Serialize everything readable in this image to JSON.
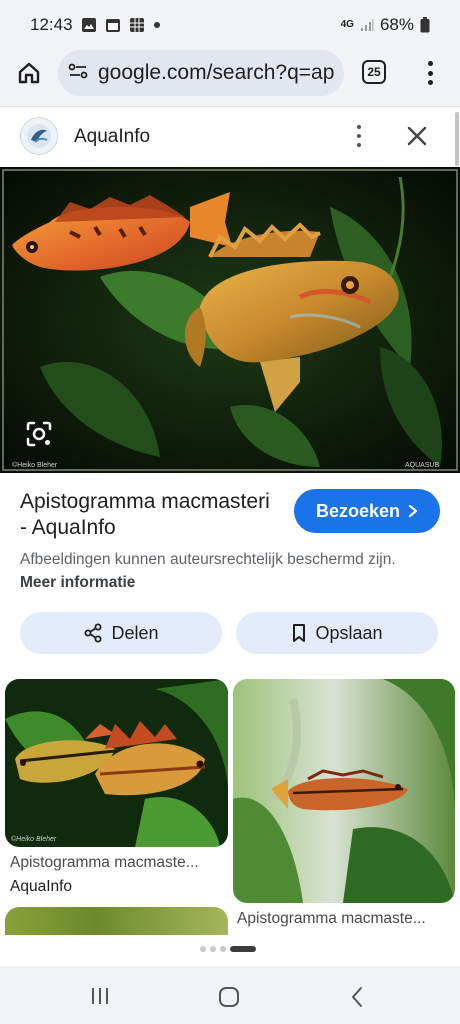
{
  "status_bar": {
    "time": "12:43",
    "network": "4G",
    "battery": "68%"
  },
  "browser": {
    "url": "google.com/search?q=ap",
    "tab_count": "25"
  },
  "source": {
    "name": "AquaInfo"
  },
  "result": {
    "title": "Apistogramma macmasteri - AquaInfo",
    "visit_label": "Bezoeken",
    "copyright_text": "Afbeeldingen kunnen auteursrechtelijk beschermd zijn.",
    "more_info_label": "Meer informatie"
  },
  "actions": {
    "share_label": "Delen",
    "save_label": "Opslaan"
  },
  "related": [
    {
      "title": "Apistogramma macmaste...",
      "source": "AquaInfo"
    },
    {
      "title": "Apistogramma macmaste..."
    }
  ],
  "colors": {
    "accent": "#1a73e8",
    "action_button_bg": "#e3ecfa",
    "chrome_bg": "#f1f3f7"
  },
  "icons": [
    "home-icon",
    "site-info-icon",
    "tabs-icon",
    "more-vert-icon",
    "close-icon",
    "google-lens-icon",
    "chevron-right-icon",
    "share-icon",
    "bookmark-icon"
  ]
}
